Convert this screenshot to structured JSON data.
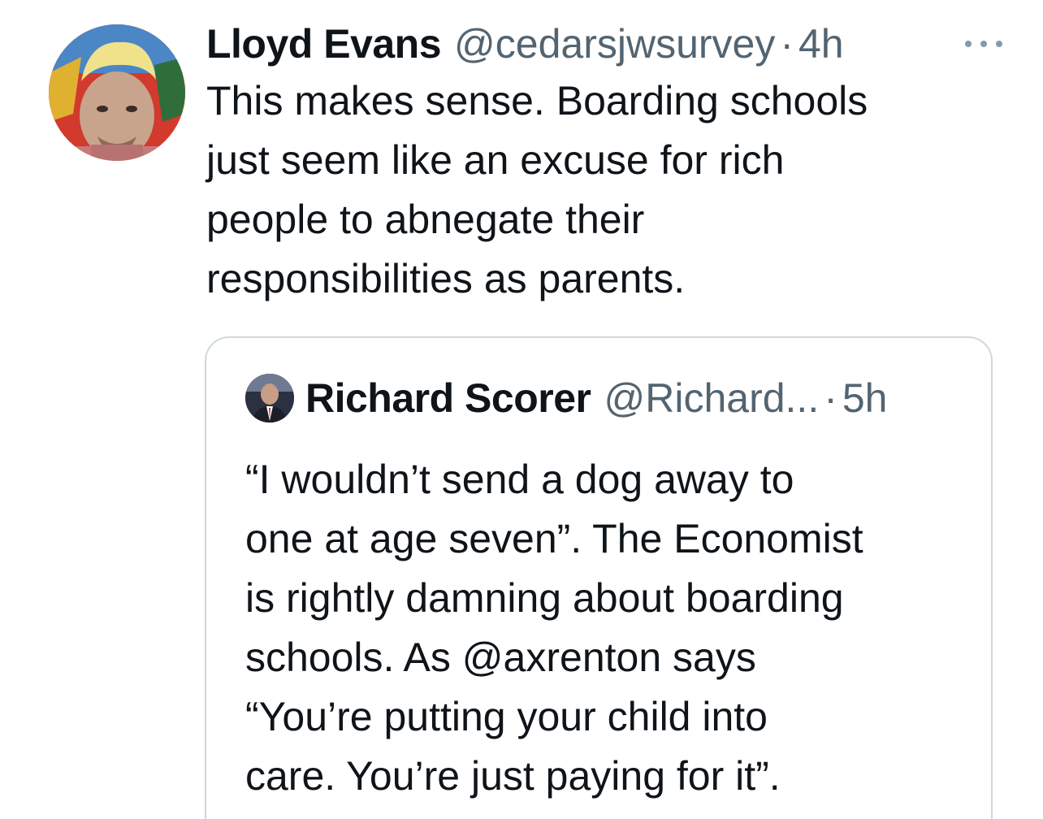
{
  "tweet": {
    "author_name": "Lloyd Evans",
    "author_handle": "@cedarsjwsurvey",
    "separator": "·",
    "time": "4h",
    "text_lines": [
      "This makes sense. Boarding schools",
      "just seem like an excuse for rich",
      "people to abnegate their",
      "responsibilities as parents."
    ],
    "more_icon": "more-horizontal-icon"
  },
  "quoted_tweet": {
    "author_name": "Richard Scorer",
    "author_handle": "@Richard...",
    "separator": "·",
    "time": "5h",
    "text_lines": [
      "“I wouldn’t send a dog away to",
      "one at age seven”. The Economist",
      "is rightly damning about boarding",
      "schools. As @axrenton says",
      "“You’re putting your child into",
      "care. You’re just paying for it”."
    ]
  },
  "colors": {
    "text_primary": "#0f1419",
    "text_secondary": "#536471",
    "border": "#cfd9de"
  }
}
